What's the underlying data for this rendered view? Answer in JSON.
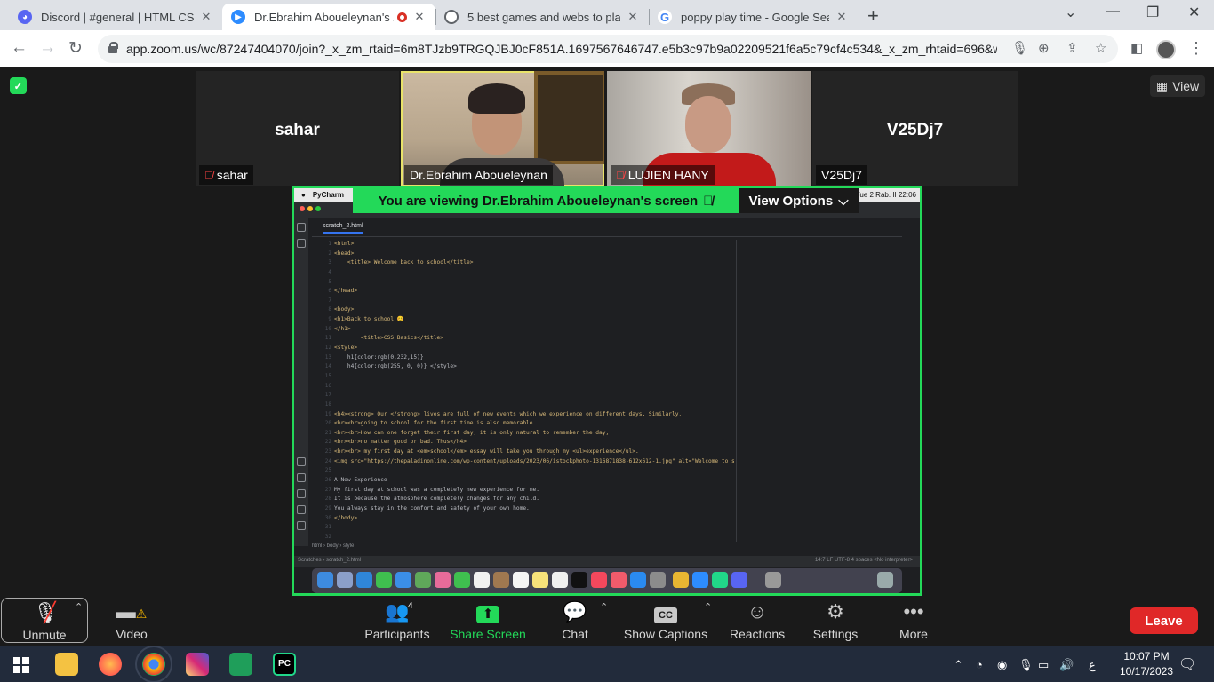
{
  "browser": {
    "tabs": [
      {
        "title": "Discord | #general | HTML CSS P",
        "icon": "discord-icon",
        "color": "#5865f2"
      },
      {
        "title": "Dr.Ebrahim Aboueleynan's Z",
        "icon": "zoom-icon",
        "color": "#2d8cff",
        "active": true
      },
      {
        "title": "5 best games and webs to play g",
        "icon": "globe-icon",
        "color": "#5f6368"
      },
      {
        "title": "poppy play time - Google Searc",
        "icon": "google-icon",
        "color": "#4285f4"
      }
    ],
    "url": "app.zoom.us/wc/87247404070/join?_x_zm_rtaid=6m8TJzb9TRGQJBJ0cF851A.1697567646747.e5b3c97b9a02209521f6a5c79cf4c534&_x_zm_rhtaid=696&wpk..."
  },
  "zoom": {
    "view_label": "View",
    "participants_tiles": [
      {
        "name": "sahar",
        "big_name": "sahar",
        "muted": true
      },
      {
        "name": "Dr.Ebrahim Aboueleynan",
        "video": true
      },
      {
        "name": "LUJIEN HANY",
        "video": true,
        "muted": true
      },
      {
        "name": "V25Dj7",
        "big_name": "V25Dj7"
      }
    ],
    "share_banner": "You are viewing  Dr.Ebrahim Aboueleynan's screen",
    "view_options": "View Options",
    "mac_menu": {
      "app": "PyCharm",
      "clock": "Tue 2 Rab. II  22:06"
    },
    "ide": {
      "tab": "scratch_2.html",
      "code_lines": [
        "<html>",
        "<head>",
        "    <title> Welcome back to school</title>",
        "",
        "",
        "</head>",
        "",
        "<body>",
        "<h1>Back to school 😊",
        "</h1>",
        "        <title>CSS Basics</title>",
        "<style>",
        "    h1{color:rgb(0,232,15)}",
        "    h4{color:rgb(255, 0, 0)} </style>",
        "",
        "",
        "",
        "",
        "<h4><strong> Our </strong> lives are full of new events which we experience on different days. Similarly,",
        "<br><br>going to school for the first time is also memorable.",
        "<br><br>How can one forget their first day, it is only natural to remember the day,",
        "<br><br>no matter good or bad. Thus</h4>",
        "<br><br> my first day at <em>school</em> essay will take you through my <ul>experience</ul>.",
        "<img src=\"https://thepaladinonline.com/wp-content/uploads/2023/06/istockphoto-1316871838-612x612-1.jpg\" alt=\"Welcome to school\">",
        "",
        "A New Experience",
        "My first day at school was a completely new experience for me.",
        "It is because the atmosphere completely changes for any child.",
        "You always stay in the comfort and safety of your own home.",
        "</body>",
        "",
        ""
      ],
      "breadcrumbs": "html  ›  body  ›  style",
      "status_left": "Scratches  ›  scratch_2.html",
      "status_right": "14:7   LF   UTF-8   4 spaces   <No interpreter>"
    },
    "toolbar": {
      "unmute": "Unmute",
      "video": "Video",
      "participants": "Participants",
      "participants_count": "4",
      "share": "Share Screen",
      "chat": "Chat",
      "captions": "Show Captions",
      "reactions": "Reactions",
      "settings": "Settings",
      "more": "More",
      "leave": "Leave"
    }
  },
  "taskbar": {
    "time": "10:07 PM",
    "date": "10/17/2023",
    "lang": "ع"
  }
}
